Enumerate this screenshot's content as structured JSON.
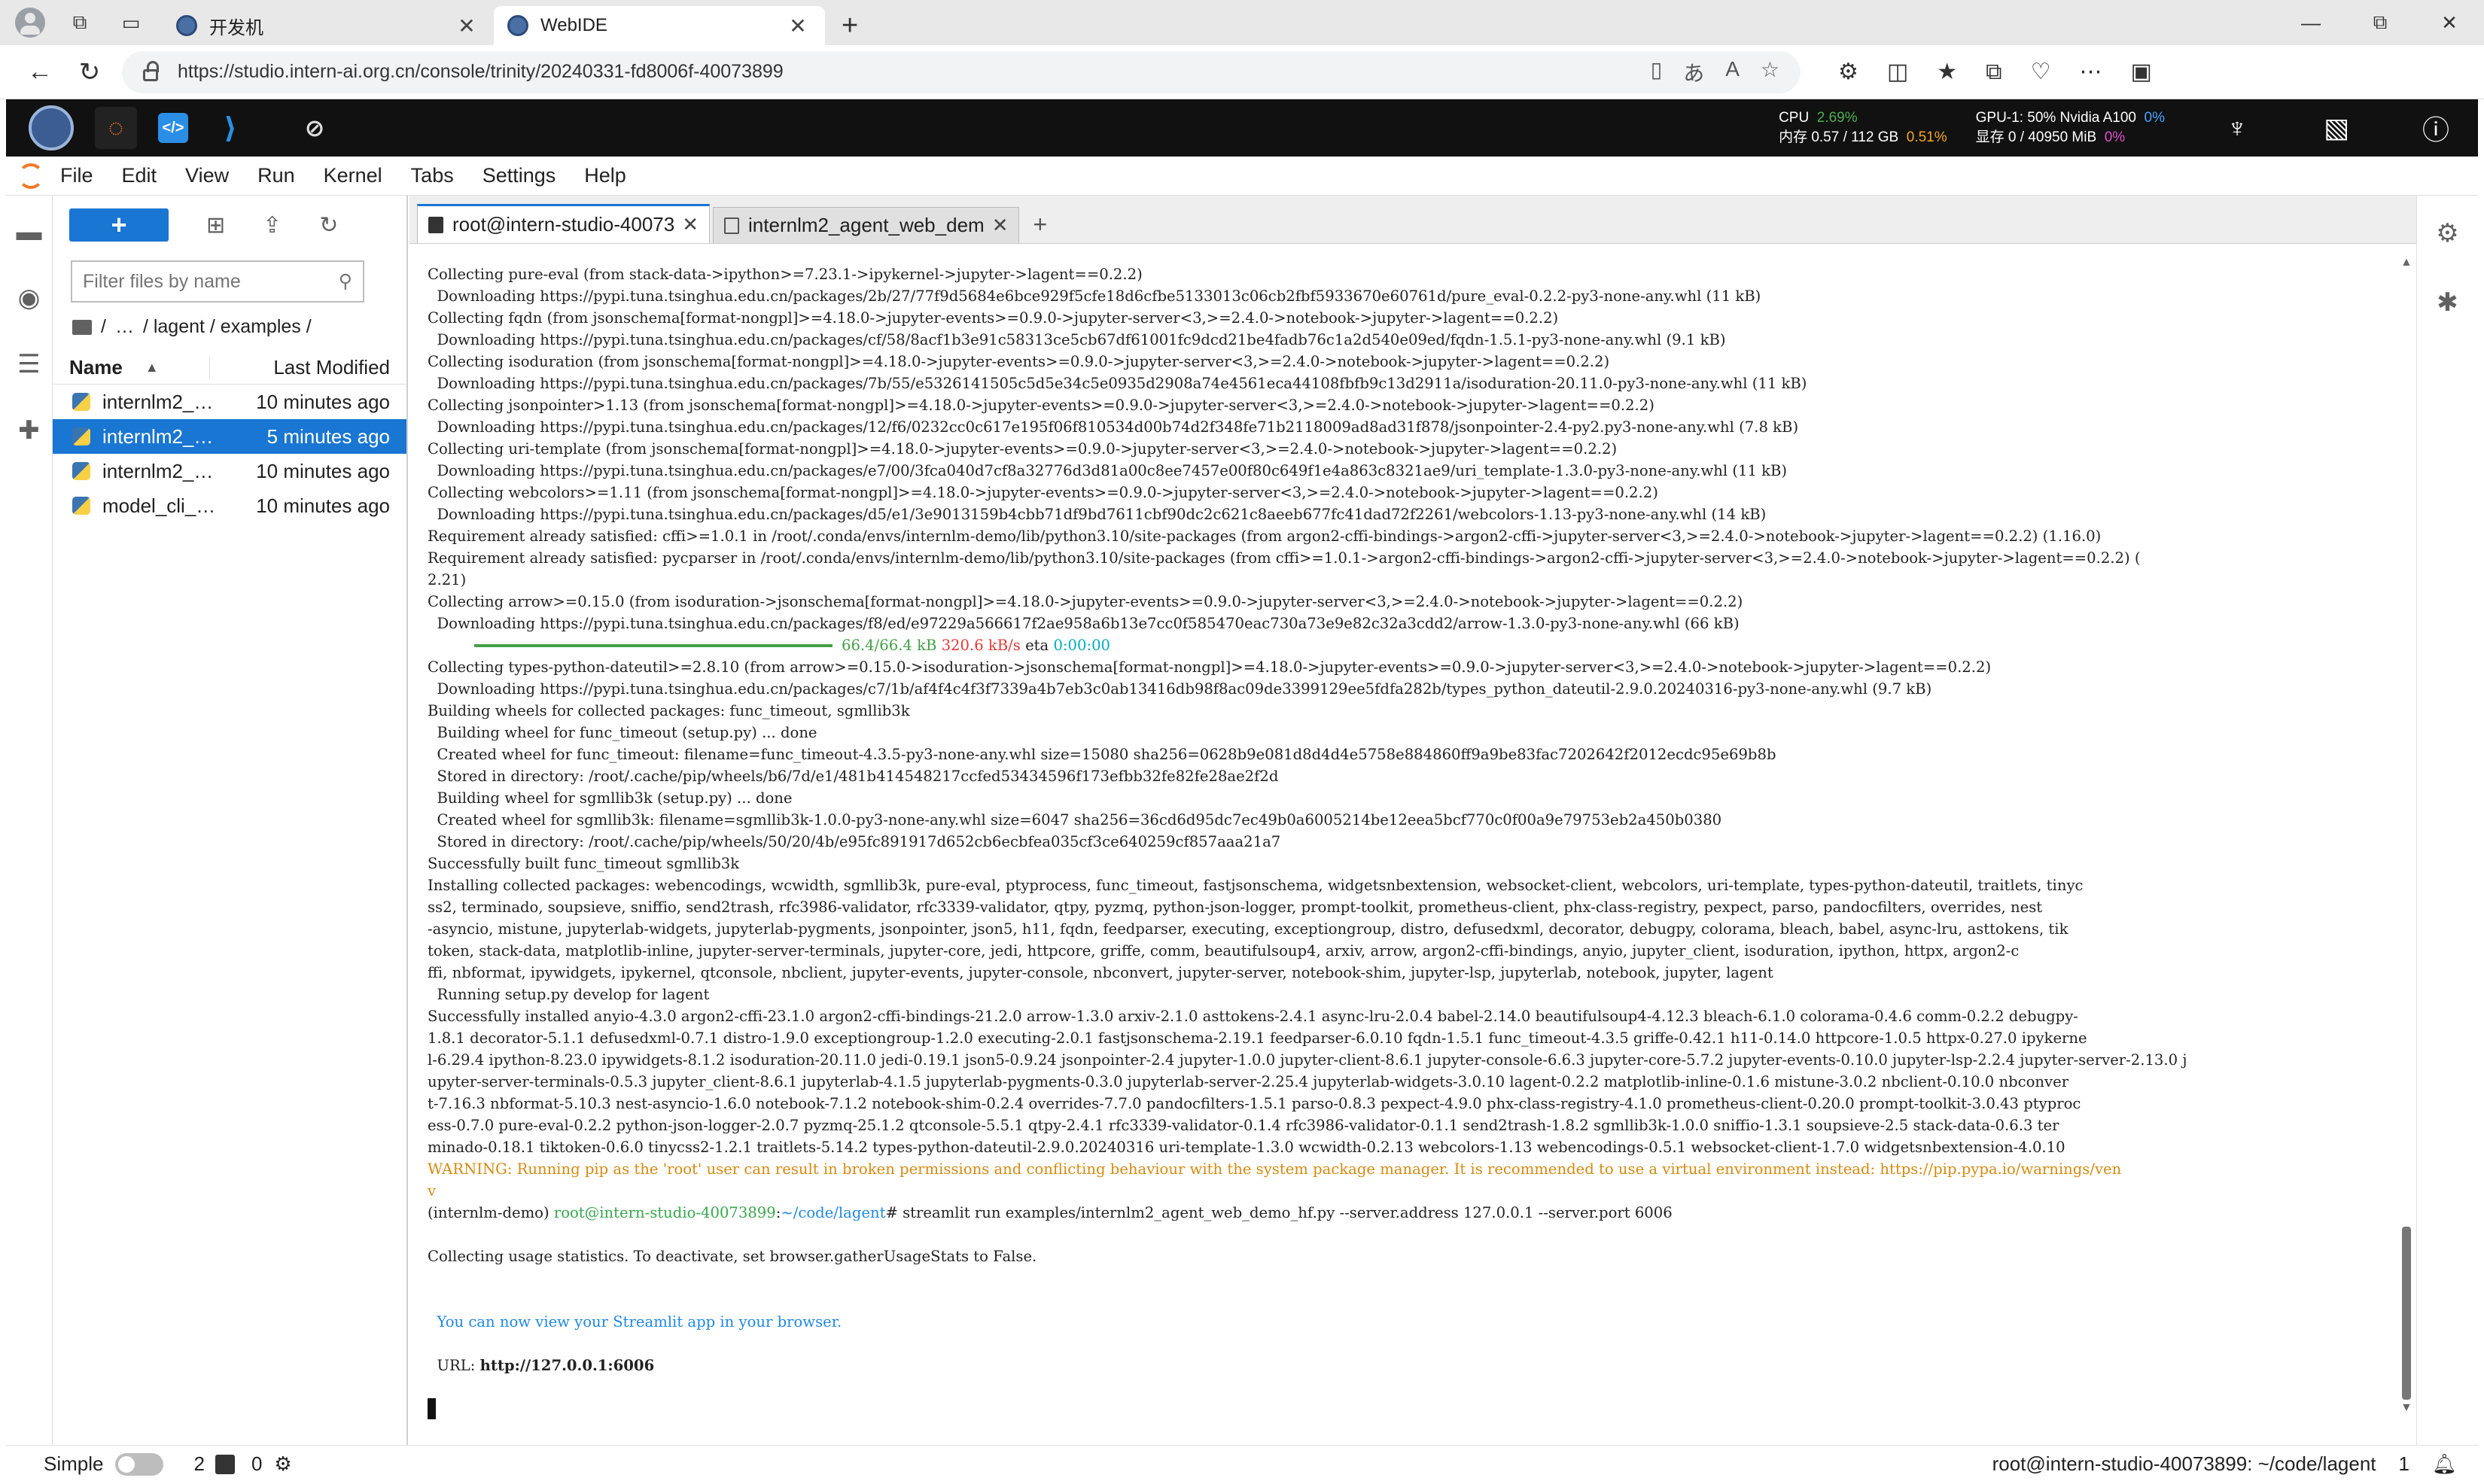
{
  "browser": {
    "tabs": [
      {
        "title": "开发机",
        "active": false
      },
      {
        "title": "WebIDE",
        "active": true
      }
    ],
    "new_tab": "+",
    "url": "https://studio.intern-ai.org.cn/console/trinity/20240331-fd8006f-40073899",
    "window_controls": {
      "minimize": "—",
      "maximize": "⧉",
      "close": "✕"
    }
  },
  "topbar": {
    "cpu_label": "CPU",
    "cpu_value": "2.69%",
    "mem_label": "内存 0.57 / 112 GB",
    "mem_value": "0.51%",
    "gpu_label": "GPU-1: 50% Nvidia A100",
    "gpu_value": "0%",
    "vram_label": "显存 0 / 40950 MiB",
    "vram_value": "0%"
  },
  "menu": [
    "File",
    "Edit",
    "View",
    "Run",
    "Kernel",
    "Tabs",
    "Settings",
    "Help"
  ],
  "filebrowser": {
    "new_label": "+",
    "filter_placeholder": "Filter files by name",
    "breadcrumb": [
      "/",
      "…",
      "/ lagent / examples /"
    ],
    "col_name": "Name",
    "col_modified": "Last Modified",
    "files": [
      {
        "name": "internlm2_…",
        "modified": "10 minutes ago",
        "selected": false
      },
      {
        "name": "internlm2_…",
        "modified": "5 minutes ago",
        "selected": true
      },
      {
        "name": "internlm2_…",
        "modified": "10 minutes ago",
        "selected": false
      },
      {
        "name": "model_cli_…",
        "modified": "10 minutes ago",
        "selected": false
      }
    ]
  },
  "doc_tabs": [
    {
      "label": "root@intern-studio-40073",
      "active": true
    },
    {
      "label": "internlm2_agent_web_dem",
      "active": false
    }
  ],
  "terminal": {
    "lines_before_progress": [
      "Collecting pure-eval (from stack-data->ipython>=7.23.1->ipykernel->jupyter->lagent==0.2.2)",
      "  Downloading https://pypi.tuna.tsinghua.edu.cn/packages/2b/27/77f9d5684e6bce929f5cfe18d6cfbe5133013c06cb2fbf5933670e60761d/pure_eval-0.2.2-py3-none-any.whl (11 kB)",
      "Collecting fqdn (from jsonschema[format-nongpl]>=4.18.0->jupyter-events>=0.9.0->jupyter-server<3,>=2.4.0->notebook->jupyter->lagent==0.2.2)",
      "  Downloading https://pypi.tuna.tsinghua.edu.cn/packages/cf/58/8acf1b3e91c58313ce5cb67df61001fc9dcd21be4fadb76c1a2d540e09ed/fqdn-1.5.1-py3-none-any.whl (9.1 kB)",
      "Collecting isoduration (from jsonschema[format-nongpl]>=4.18.0->jupyter-events>=0.9.0->jupyter-server<3,>=2.4.0->notebook->jupyter->lagent==0.2.2)",
      "  Downloading https://pypi.tuna.tsinghua.edu.cn/packages/7b/55/e5326141505c5d5e34c5e0935d2908a74e4561eca44108fbfb9c13d2911a/isoduration-20.11.0-py3-none-any.whl (11 kB)",
      "Collecting jsonpointer>1.13 (from jsonschema[format-nongpl]>=4.18.0->jupyter-events>=0.9.0->jupyter-server<3,>=2.4.0->notebook->jupyter->lagent==0.2.2)",
      "  Downloading https://pypi.tuna.tsinghua.edu.cn/packages/12/f6/0232cc0c617e195f06f810534d00b74d2f348fe71b2118009ad8ad31f878/jsonpointer-2.4-py2.py3-none-any.whl (7.8 kB)",
      "Collecting uri-template (from jsonschema[format-nongpl]>=4.18.0->jupyter-events>=0.9.0->jupyter-server<3,>=2.4.0->notebook->jupyter->lagent==0.2.2)",
      "  Downloading https://pypi.tuna.tsinghua.edu.cn/packages/e7/00/3fca040d7cf8a32776d3d81a00c8ee7457e00f80c649f1e4a863c8321ae9/uri_template-1.3.0-py3-none-any.whl (11 kB)",
      "Collecting webcolors>=1.11 (from jsonschema[format-nongpl]>=4.18.0->jupyter-events>=0.9.0->jupyter-server<3,>=2.4.0->notebook->jupyter->lagent==0.2.2)",
      "  Downloading https://pypi.tuna.tsinghua.edu.cn/packages/d5/e1/3e9013159b4cbb71df9bd7611cbf90dc2c621c8aeeb677fc41dad72f2261/webcolors-1.13-py3-none-any.whl (14 kB)",
      "Requirement already satisfied: cffi>=1.0.1 in /root/.conda/envs/internlm-demo/lib/python3.10/site-packages (from argon2-cffi-bindings->argon2-cffi->jupyter-server<3,>=2.4.0->notebook->jupyter->lagent==0.2.2) (1.16.0)",
      "Requirement already satisfied: pycparser in /root/.conda/envs/internlm-demo/lib/python3.10/site-packages (from cffi>=1.0.1->argon2-cffi-bindings->argon2-cffi->jupyter-server<3,>=2.4.0->notebook->jupyter->lagent==0.2.2) (",
      "2.21)",
      "Collecting arrow>=0.15.0 (from isoduration->jsonschema[format-nongpl]>=4.18.0->jupyter-events>=0.9.0->jupyter-server<3,>=2.4.0->notebook->jupyter->lagent==0.2.2)",
      "  Downloading https://pypi.tuna.tsinghua.edu.cn/packages/f8/ed/e97229a566617f2ae958a6b13e7cc0f585470eac730a73e9e82c32a3cdd2/arrow-1.3.0-py3-none-any.whl (66 kB)"
    ],
    "progress": {
      "fraction": 1.0,
      "size": "66.4/66.4 kB",
      "speed": "320.6 kB/s",
      "eta_label": "eta",
      "eta": "0:00:00"
    },
    "lines_after_progress": [
      "Collecting types-python-dateutil>=2.8.10 (from arrow>=0.15.0->isoduration->jsonschema[format-nongpl]>=4.18.0->jupyter-events>=0.9.0->jupyter-server<3,>=2.4.0->notebook->jupyter->lagent==0.2.2)",
      "  Downloading https://pypi.tuna.tsinghua.edu.cn/packages/c7/1b/af4f4c4f3f7339a4b7eb3c0ab13416db98f8ac09de3399129ee5fdfa282b/types_python_dateutil-2.9.0.20240316-py3-none-any.whl (9.7 kB)",
      "Building wheels for collected packages: func_timeout, sgmllib3k",
      "  Building wheel for func_timeout (setup.py) ... done",
      "  Created wheel for func_timeout: filename=func_timeout-4.3.5-py3-none-any.whl size=15080 sha256=0628b9e081d8d4d4e5758e884860ff9a9be83fac7202642f2012ecdc95e69b8b",
      "  Stored in directory: /root/.cache/pip/wheels/b6/7d/e1/481b414548217ccfed53434596f173efbb32fe82fe28ae2f2d",
      "  Building wheel for sgmllib3k (setup.py) ... done",
      "  Created wheel for sgmllib3k: filename=sgmllib3k-1.0.0-py3-none-any.whl size=6047 sha256=36cd6d95dc7ec49b0a6005214be12eea5bcf770c0f00a9e79753eb2a450b0380",
      "  Stored in directory: /root/.cache/pip/wheels/50/20/4b/e95fc891917d652cb6ecbfea035cf3ce640259cf857aaa21a7",
      "Successfully built func_timeout sgmllib3k",
      "Installing collected packages: webencodings, wcwidth, sgmllib3k, pure-eval, ptyprocess, func_timeout, fastjsonschema, widgetsnbextension, websocket-client, webcolors, uri-template, types-python-dateutil, traitlets, tinyc",
      "ss2, terminado, soupsieve, sniffio, send2trash, rfc3986-validator, rfc3339-validator, qtpy, pyzmq, python-json-logger, prompt-toolkit, prometheus-client, phx-class-registry, pexpect, parso, pandocfilters, overrides, nest",
      "-asyncio, mistune, jupyterlab-widgets, jupyterlab-pygments, jsonpointer, json5, h11, fqdn, feedparser, executing, exceptiongroup, distro, defusedxml, decorator, debugpy, colorama, bleach, babel, async-lru, asttokens, tik",
      "token, stack-data, matplotlib-inline, jupyter-server-terminals, jupyter-core, jedi, httpcore, griffe, comm, beautifulsoup4, arxiv, arrow, argon2-cffi-bindings, anyio, jupyter_client, isoduration, ipython, httpx, argon2-c",
      "ffi, nbformat, ipywidgets, ipykernel, qtconsole, nbclient, jupyter-events, jupyter-console, nbconvert, jupyter-server, notebook-shim, jupyter-lsp, jupyterlab, notebook, jupyter, lagent",
      "  Running setup.py develop for lagent",
      "Successfully installed anyio-4.3.0 argon2-cffi-23.1.0 argon2-cffi-bindings-21.2.0 arrow-1.3.0 arxiv-2.1.0 asttokens-2.4.1 async-lru-2.0.4 babel-2.14.0 beautifulsoup4-4.12.3 bleach-6.1.0 colorama-0.4.6 comm-0.2.2 debugpy-",
      "1.8.1 decorator-5.1.1 defusedxml-0.7.1 distro-1.9.0 exceptiongroup-1.2.0 executing-2.0.1 fastjsonschema-2.19.1 feedparser-6.0.10 fqdn-1.5.1 func_timeout-4.3.5 griffe-0.42.1 h11-0.14.0 httpcore-1.0.5 httpx-0.27.0 ipykerne",
      "l-6.29.4 ipython-8.23.0 ipywidgets-8.1.2 isoduration-20.11.0 jedi-0.19.1 json5-0.9.24 jsonpointer-2.4 jupyter-1.0.0 jupyter-client-8.6.1 jupyter-console-6.6.3 jupyter-core-5.7.2 jupyter-events-0.10.0 jupyter-lsp-2.2.4 jupyter-server-2.13.0 j",
      "upyter-server-terminals-0.5.3 jupyter_client-8.6.1 jupyterlab-4.1.5 jupyterlab-pygments-0.3.0 jupyterlab-server-2.25.4 jupyterlab-widgets-3.0.10 lagent-0.2.2 matplotlib-inline-0.1.6 mistune-3.0.2 nbclient-0.10.0 nbconver",
      "t-7.16.3 nbformat-5.10.3 nest-asyncio-1.6.0 notebook-7.1.2 notebook-shim-0.2.4 overrides-7.7.0 pandocfilters-1.5.1 parso-0.8.3 pexpect-4.9.0 phx-class-registry-4.1.0 prometheus-client-0.20.0 prompt-toolkit-3.0.43 ptyproc",
      "ess-0.7.0 pure-eval-0.2.2 python-json-logger-2.0.7 pyzmq-25.1.2 qtconsole-5.5.1 qtpy-2.4.1 rfc3339-validator-0.1.4 rfc3986-validator-0.1.1 send2trash-1.8.2 sgmllib3k-1.0.0 sniffio-1.3.1 soupsieve-2.5 stack-data-0.6.3 ter",
      "minado-0.18.1 tiktoken-0.6.0 tinycss2-1.2.1 traitlets-5.14.2 types-python-dateutil-2.9.0.20240316 uri-template-1.3.0 wcwidth-0.2.13 webcolors-1.13 webencodings-0.5.1 websocket-client-1.7.0 widgetsnbextension-4.0.10"
    ],
    "warning_line_1": "WARNING: Running pip as the 'root' user can result in broken permissions and conflicting behaviour with the system package manager. It is recommended to use a virtual environment instead: https://pip.pypa.io/warnings/ven",
    "warning_line_2": "v",
    "prompt_env": "(internlm-demo) ",
    "prompt_user": "root@intern-studio-40073899",
    "prompt_sep": ":",
    "prompt_path": "~/code/lagent",
    "prompt_cmd": "# streamlit run examples/internlm2_agent_web_demo_hf.py --server.address 127.0.0.1 --server.port 6006",
    "stats_line": "Collecting usage statistics. To deactivate, set browser.gatherUsageStats to False.",
    "view_line": "  You can now view your Streamlit app in your browser.",
    "url_label": "  URL: ",
    "url_value": "http://127.0.0.1:6006"
  },
  "statusbar": {
    "mode_label": "Simple",
    "terminals_count": "2",
    "kernels_count": "0",
    "right_text": "root@intern-studio-40073899: ~/code/lagent",
    "line_num": "1"
  }
}
